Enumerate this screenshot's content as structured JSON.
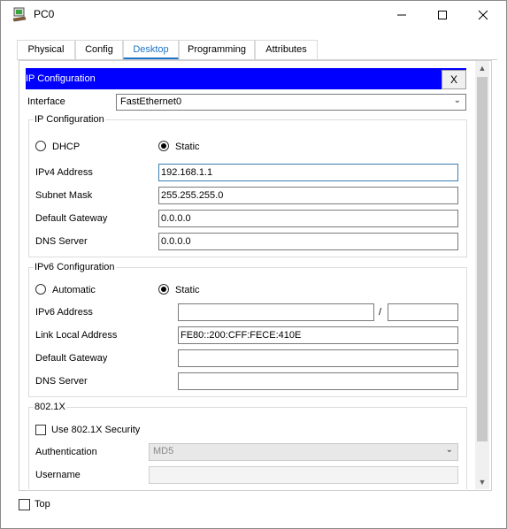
{
  "window": {
    "title": "PC0"
  },
  "tabs": [
    "Physical",
    "Config",
    "Desktop",
    "Programming",
    "Attributes"
  ],
  "active_tab": "Desktop",
  "panel": {
    "title": "IP Configuration",
    "close_label": "X"
  },
  "interface": {
    "label": "Interface",
    "value": "FastEthernet0"
  },
  "ipv4": {
    "group_title": "IP Configuration",
    "dhcp_label": "DHCP",
    "static_label": "Static",
    "mode": "Static",
    "ipv4_label": "IPv4 Address",
    "ipv4_value": "192.168.1.1",
    "mask_label": "Subnet Mask",
    "mask_value": "255.255.255.0",
    "gateway_label": "Default Gateway",
    "gateway_value": "0.0.0.0",
    "dns_label": "DNS Server",
    "dns_value": "0.0.0.0"
  },
  "ipv6": {
    "group_title": "IPv6 Configuration",
    "auto_label": "Automatic",
    "static_label": "Static",
    "mode": "Static",
    "address_label": "IPv6 Address",
    "address_value": "",
    "slash": "/",
    "prefix_value": "",
    "link_local_label": "Link Local Address",
    "link_local_value": "FE80::200:CFF:FECE:410E",
    "gateway_label": "Default Gateway",
    "gateway_value": "",
    "dns_label": "DNS Server",
    "dns_value": ""
  },
  "dot1x": {
    "group_title": "802.1X",
    "use_label": "Use 802.1X Security",
    "auth_label": "Authentication",
    "auth_value": "MD5",
    "username_label": "Username"
  },
  "footer": {
    "top_label": "Top"
  }
}
